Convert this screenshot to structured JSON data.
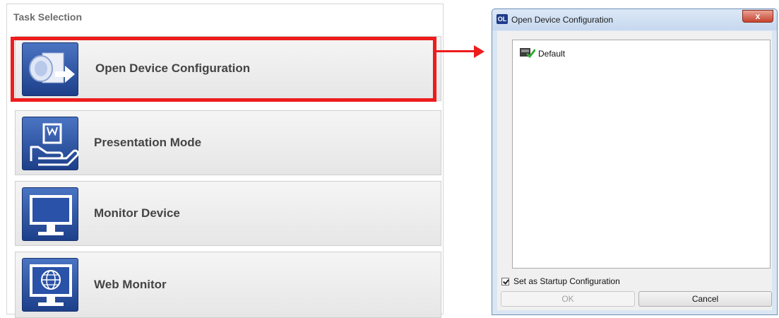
{
  "task_panel": {
    "title": "Task Selection",
    "items": [
      {
        "label": "Open Device Configuration"
      },
      {
        "label": "Presentation Mode"
      },
      {
        "label": "Monitor Device"
      },
      {
        "label": "Web Monitor"
      }
    ]
  },
  "dialog": {
    "app_icon_text": "OL",
    "title": "Open Device Configuration",
    "close_label": "x",
    "list_items": [
      {
        "label": "Default"
      }
    ],
    "startup_checkbox_label": "Set as Startup Configuration",
    "startup_checked": true,
    "ok_label": "OK",
    "cancel_label": "Cancel"
  },
  "colors": {
    "highlight": "#ee1c1c",
    "icon_blue": "#2a52a8"
  },
  "icons": [
    "open-config-icon",
    "presentation-icon",
    "monitor-icon",
    "web-monitor-icon",
    "config-file-icon"
  ]
}
